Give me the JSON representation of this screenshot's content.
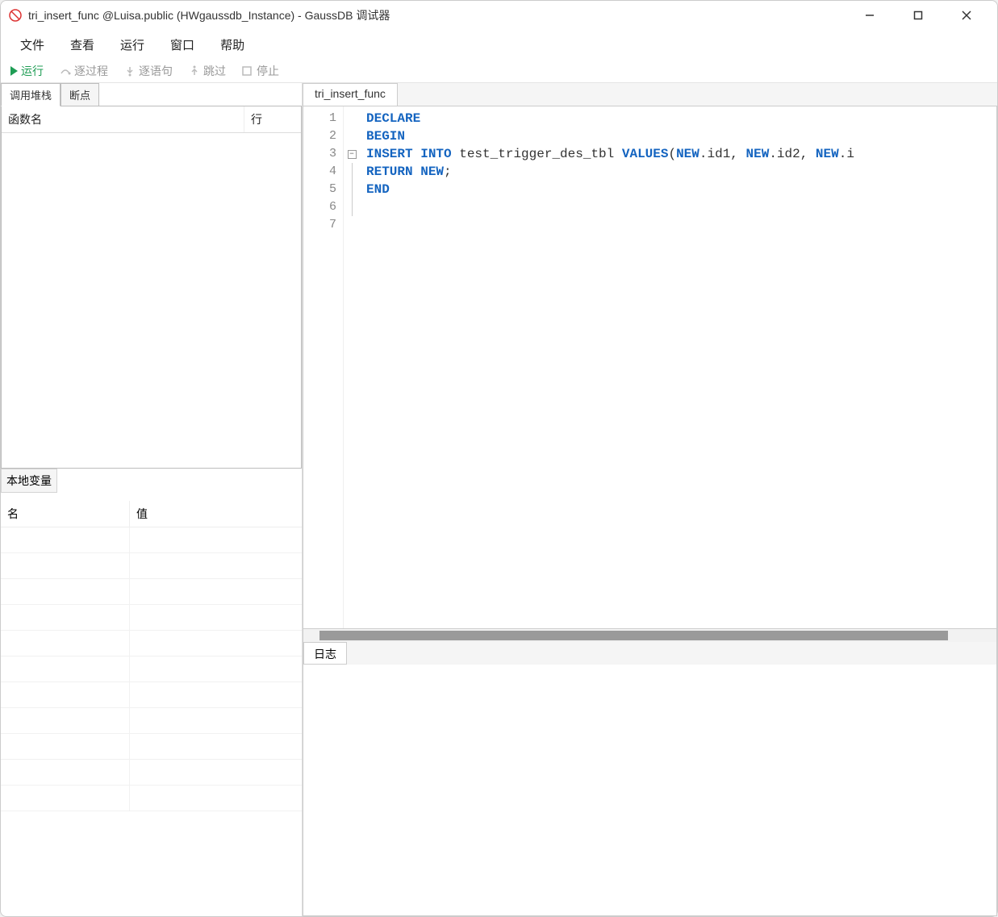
{
  "window": {
    "title": "tri_insert_func @Luisa.public (HWgaussdb_Instance) - GaussDB 调试器"
  },
  "menu": {
    "file": "文件",
    "view": "查看",
    "run": "运行",
    "window": "窗口",
    "help": "帮助"
  },
  "toolbar": {
    "run": "运行",
    "step_over": "逐过程",
    "step_into": "逐语句",
    "step_out": "跳过",
    "stop": "停止"
  },
  "left": {
    "tabs": {
      "callstack": "调用堆栈",
      "breakpoints": "断点"
    },
    "callstack_cols": {
      "func": "函数名",
      "line": "行"
    },
    "localvars_title": "本地变量",
    "localvars_cols": {
      "name": "名",
      "value": "值"
    }
  },
  "editor": {
    "tab_name": "tri_insert_func",
    "lines": [
      "1",
      "2",
      "3",
      "4",
      "5",
      "6",
      "7"
    ],
    "code": {
      "l1": "",
      "l2": "DECLARE",
      "l3": "BEGIN",
      "l4_pre": "INSERT INTO",
      "l4_mid": " test_trigger_des_tbl ",
      "l4_values": "VALUES",
      "l4_open": "(",
      "l4_new1": "NEW",
      "l4_id1": ".id1, ",
      "l4_new2": "NEW",
      "l4_id2": ".id2, ",
      "l4_new3": "NEW",
      "l4_id3": ".i",
      "l5_a": "RETURN",
      "l5_b": " NEW",
      "l5_c": ";",
      "l6": "END"
    }
  },
  "log": {
    "tab": "日志"
  }
}
